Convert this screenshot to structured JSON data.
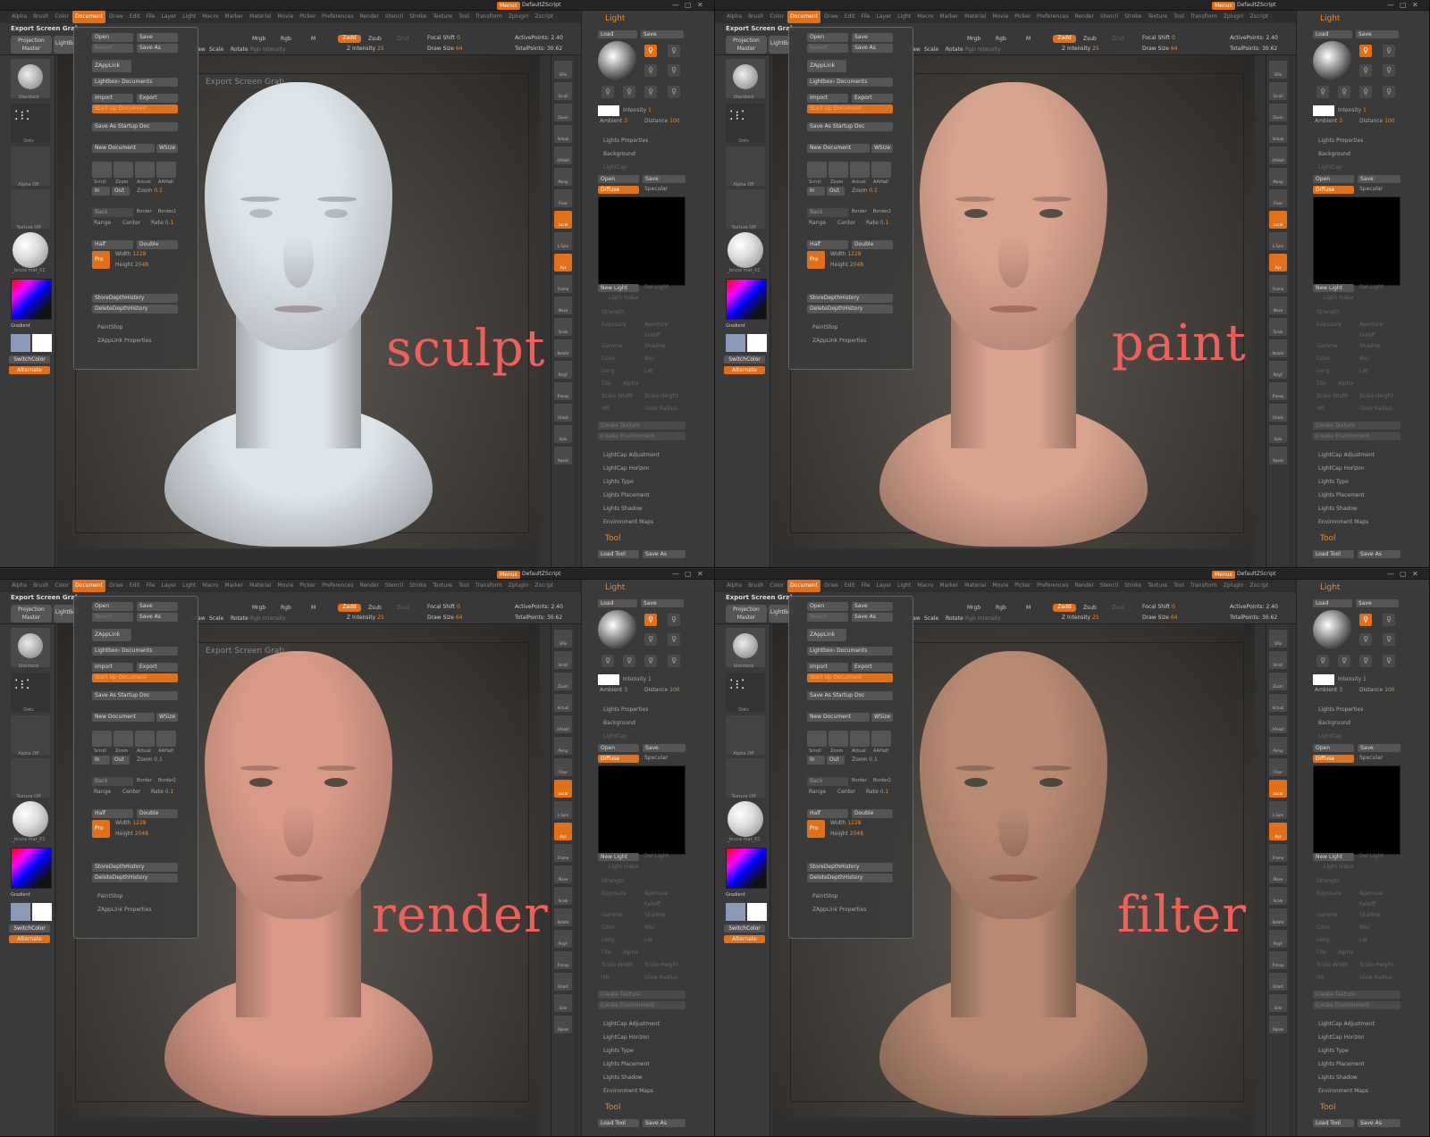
{
  "window": {
    "title": "Export Screen Grab",
    "menus_label": "Menus",
    "script_name": "DefaultZScript",
    "win_controls": [
      "—",
      "▢",
      "✕"
    ]
  },
  "menus": [
    "Alpha",
    "Brush",
    "Color",
    "Document",
    "Draw",
    "Edit",
    "File",
    "Layer",
    "Light",
    "Macro",
    "Marker",
    "Material",
    "Movie",
    "Picker",
    "Preferences",
    "Render",
    "Stencil",
    "Stroke",
    "Texture",
    "Tool",
    "Transform",
    "Zplugin",
    "Zscript"
  ],
  "active_menu": "Document",
  "toolbar": {
    "projection_master": "Projection Master",
    "lightbox": "LightBox",
    "draw": "Draw",
    "move": "Move",
    "scale": "Scale",
    "rotate": "Rotate",
    "mrgb": "Mrgb",
    "rgb": "Rgb",
    "m": "M",
    "rgb_intensity": "Rgb Intensity",
    "zadd": "Zadd",
    "zsub": "Zsub",
    "zcut": "Zcut",
    "z_intensity_label": "Z Intensity",
    "z_intensity_value": "25",
    "focal_shift_label": "Focal Shift",
    "focal_shift_value": "0",
    "draw_size_label": "Draw Size",
    "draw_size_value": "64",
    "active_points_label": "ActivePoints:",
    "active_points_value": "2.40",
    "total_points_label": "TotalPoints:",
    "total_points_value": "30.62"
  },
  "left_shelf": {
    "brush": "Standard",
    "stroke": "Dots",
    "alpha": "Alpha Off",
    "texture": "Texture Off",
    "material": "_bruce mat_02",
    "gradient": "Gradient",
    "switch_color": "SwitchColor",
    "alternate": "Alternate"
  },
  "document_menu": {
    "open": "Open",
    "save": "Save",
    "revert": "Revert",
    "save_as": "Save As",
    "zapplink": "ZAppLink",
    "lightbox_documents": "Lightbox› Documents",
    "import": "Import",
    "export": "Export",
    "start_up": "Start Up Document",
    "save_startup": "Save As Startup Doc",
    "new_document": "New Document",
    "wsize": "WSize",
    "scroll": "Scroll",
    "zoom": "Zoom",
    "actual": "Actual",
    "aahalf": "AAHalf",
    "in": "In",
    "out": "Out",
    "zoom_label": "Zoom",
    "zoom_value": "0.1",
    "back": "Back",
    "border": "Border",
    "border2": "Border2",
    "range": "Range",
    "center": "Center",
    "rate_label": "Rate",
    "rate_value": "0.1",
    "half": "Half",
    "double": "Double",
    "pro": "Pro",
    "width_label": "Width",
    "width_value": "1228",
    "height_label": "Height",
    "height_value": "2048",
    "store_depth": "StoreDepthHistory",
    "delete_depth": "DeleteDepthHistory",
    "paint_stop": "PaintStop",
    "zapplink_props": "ZAppLink Properties"
  },
  "viewport": {
    "export_label": "Export Screen Grab"
  },
  "right_shelf": [
    "SPix",
    "Scroll",
    "Zoom",
    "Actual",
    "AAHalf",
    "Persp",
    "Floor",
    "Local",
    "L.Sym",
    "Xyz",
    "Frame",
    "Move",
    "Scale",
    "Rotate",
    "PolyF",
    "Transp",
    "Ghost",
    "Solo",
    "Xpose"
  ],
  "light_panel": {
    "title": "Light",
    "load": "Load",
    "save": "Save",
    "intensity_label": "Intensity",
    "intensity_value": "1",
    "ambient_label": "Ambient",
    "ambient_value": "3",
    "distance_label": "Distance",
    "distance_value": "100",
    "lights_properties": "Lights Properties",
    "background": "Background",
    "lightcap": "LightCap",
    "open": "Open",
    "save2": "Save",
    "diffuse": "Diffuse",
    "specular": "Specular",
    "new_light": "New Light",
    "del_light": "Del Light",
    "light_index": "Light Index",
    "strength": "Strength",
    "aperture": "Aperture",
    "exposure": "Exposure",
    "falloff": "Falloff",
    "gamma": "Gamma",
    "shadow": "Shadow",
    "color": "Color",
    "blur": "Blur",
    "long": "Long",
    "lat": "Lat",
    "tile": "Tile",
    "alpha": "Alpha",
    "scale_width": "Scale Width",
    "scale_height": "Scale Height",
    "hlt": "Hlt",
    "glow_radius": "Glow Radius",
    "create_texture": "Create Texture",
    "create_environment": "Create Environment",
    "lightcap_adjustment": "LightCap Adjustment",
    "lightcap_horizon": "LightCap Horizon",
    "lights_type": "Lights Type",
    "lights_placement": "Lights Placement",
    "lights_shadow": "Lights Shadow",
    "environment_maps": "Environment Maps",
    "tool": "Tool",
    "load_tool": "Load Tool",
    "save_as": "Save As"
  },
  "captions": [
    "sculpt",
    "paint",
    "render",
    "filter"
  ],
  "stage_colors": {
    "sculpt": "#dde4ea",
    "paint": "#d9a48e",
    "render": "#d89a87",
    "filter": "#b88a72"
  }
}
